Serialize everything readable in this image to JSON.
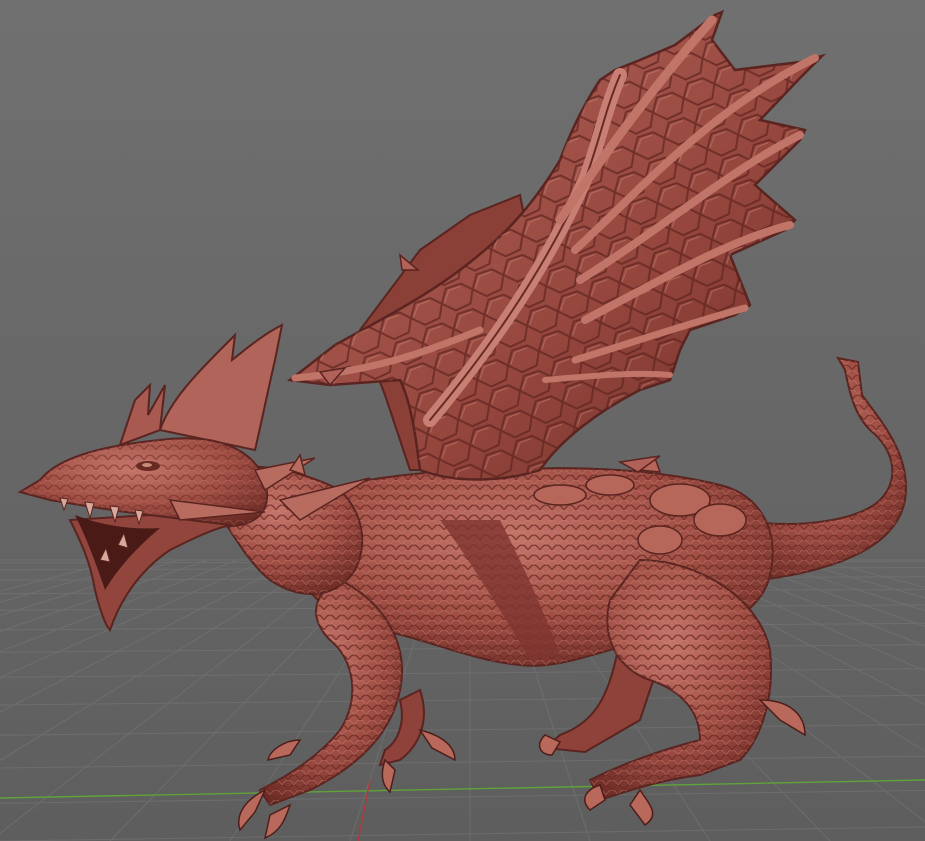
{
  "viewport": {
    "model_subject": "dragon",
    "material_color": "#a65246",
    "material_shadow": "#5a2420",
    "material_highlight": "#d48878",
    "background_top": "#6e6e6e",
    "background_bottom": "#5c5c5c",
    "grid_color": "#797979",
    "x_axis_color": "#5fa33a",
    "y_axis_color": "#b23a3a"
  }
}
